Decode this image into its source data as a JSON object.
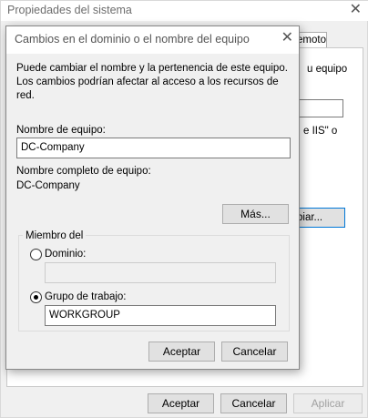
{
  "parent_window": {
    "title": "Propiedades del sistema",
    "tab_fragment": "emoto",
    "text_fragments": [
      "u equipo",
      "e IIS\" o"
    ],
    "button_fragment": "biar...",
    "buttons": {
      "accept": "Aceptar",
      "cancel": "Cancelar",
      "apply": "Aplicar"
    }
  },
  "dialog": {
    "title": "Cambios en el dominio o el nombre del equipo",
    "description": "Puede cambiar el nombre y la pertenencia de este equipo. Los cambios podrían afectar al acceso a los recursos de red.",
    "computer_name_label": "Nombre de equipo:",
    "computer_name_value": "DC-Company",
    "full_name_label": "Nombre completo de equipo:",
    "full_name_value": "DC-Company",
    "more_button": "Más...",
    "member_of": {
      "legend": "Miembro del",
      "domain_label": "Dominio:",
      "domain_value": "",
      "domain_selected": false,
      "workgroup_label": "Grupo de trabajo:",
      "workgroup_value": "WORKGROUP",
      "workgroup_selected": true
    },
    "buttons": {
      "accept": "Aceptar",
      "cancel": "Cancelar"
    }
  }
}
